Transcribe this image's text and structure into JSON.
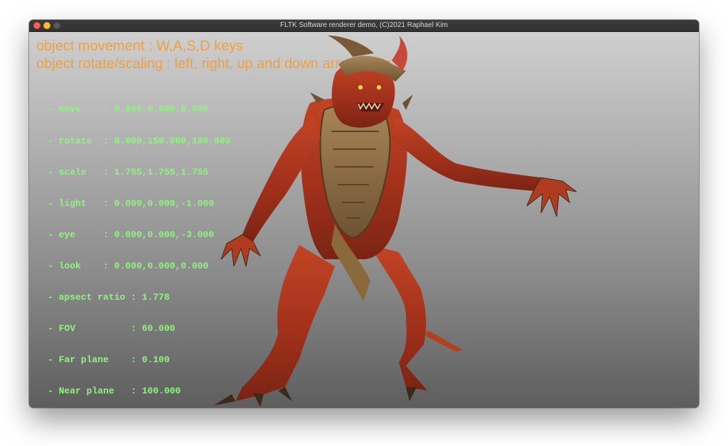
{
  "window": {
    "title": "FLTK Software renderer demo, (C)2021 Raphael Kim"
  },
  "help": {
    "line1": "object movement : W,A,S,D keys",
    "line2": "object rotate/scaling : left, right, up and down arrow keys"
  },
  "stats": [
    "- move    : 0.000,0.000,0.000",
    "- rotate  : 0.000,150.000,180.000",
    "- scale   : 1.755,1.755,1.755",
    "- light   : 0.000,0.000,-1.000",
    "- eye     : 0.000,0.000,-3.000",
    "- look    : 0.000,0.000,0.000",
    "- apsect ratio : 1.778",
    "- FOV          : 60.000",
    "- Far plane    : 0.100",
    "- Near plane   : 100.000"
  ],
  "colors": {
    "help_text": "#f0a040",
    "stats_text": "#8ef57c",
    "model_skin": "#a8331c",
    "model_armor": "#8a6a3c"
  },
  "icons": {
    "close": "close-icon",
    "minimize": "minimize-icon",
    "maximize": "maximize-icon"
  }
}
